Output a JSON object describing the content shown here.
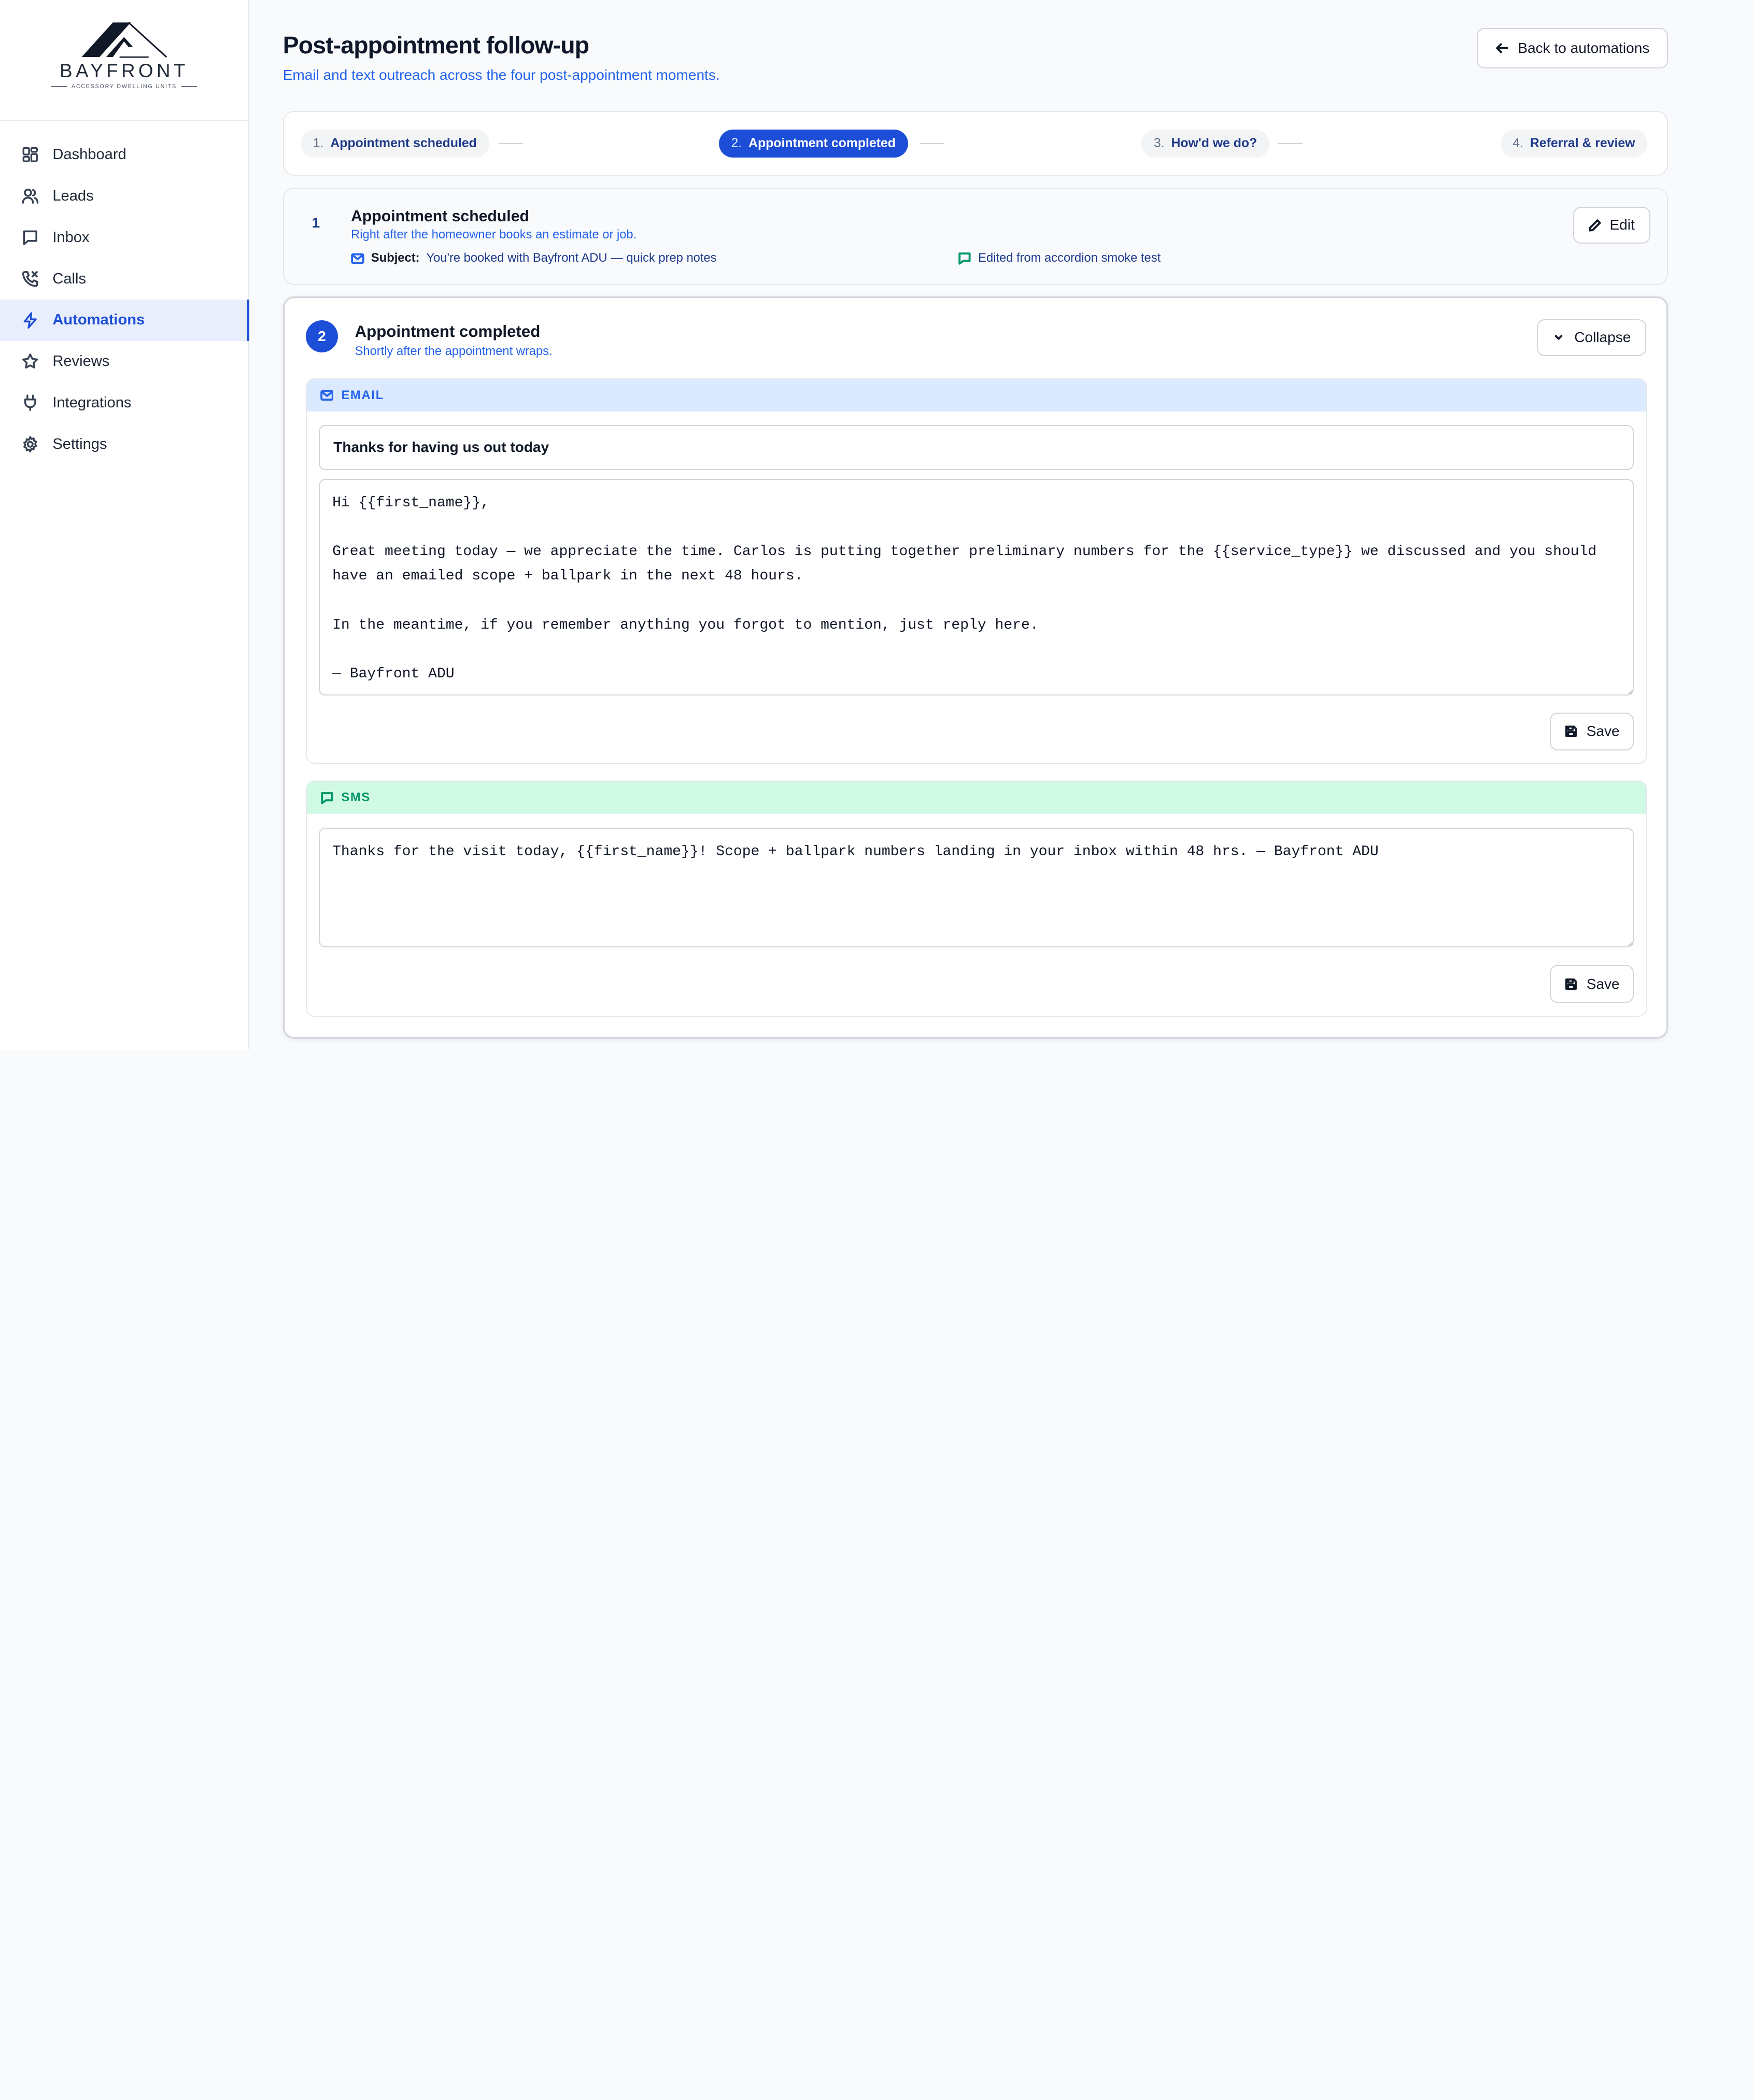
{
  "brand": {
    "name": "BAYFRONT",
    "tagline": "ACCESSORY DWELLING UNITS",
    "logo_icon": "house-roof-icon"
  },
  "sidebar": {
    "items": [
      {
        "label": "Dashboard",
        "icon": "dashboard-icon",
        "active": false
      },
      {
        "label": "Leads",
        "icon": "users-icon",
        "active": false
      },
      {
        "label": "Inbox",
        "icon": "message-icon",
        "active": false
      },
      {
        "label": "Calls",
        "icon": "phone-icon",
        "active": false
      },
      {
        "label": "Automations",
        "icon": "lightning-icon",
        "active": true
      },
      {
        "label": "Reviews",
        "icon": "star-icon",
        "active": false
      },
      {
        "label": "Integrations",
        "icon": "plug-icon",
        "active": false
      },
      {
        "label": "Settings",
        "icon": "gear-icon",
        "active": false
      }
    ]
  },
  "header": {
    "title": "Post-appointment follow-up",
    "subtitle": "Email and text outreach across the four post-appointment moments.",
    "back_label": "Back to automations"
  },
  "stepper": {
    "steps": [
      {
        "num": "1.",
        "label": "Appointment scheduled",
        "active": false
      },
      {
        "num": "2.",
        "label": "Appointment completed",
        "active": true
      },
      {
        "num": "3.",
        "label": "How'd we do?",
        "active": false
      },
      {
        "num": "4.",
        "label": "Referral & review",
        "active": false
      }
    ]
  },
  "card1": {
    "index": "1",
    "title": "Appointment scheduled",
    "description": "Right after the homeowner books an estimate or job.",
    "subject_label": "Subject:",
    "subject": "You're booked with Bayfront ADU — quick prep notes",
    "sms_preview": "Edited from accordion smoke test",
    "edit_label": "Edit"
  },
  "card2": {
    "index": "2",
    "title": "Appointment completed",
    "description": "Shortly after the appointment wraps.",
    "collapse_label": "Collapse",
    "email": {
      "heading": "EMAIL",
      "subject": "Thanks for having us out today",
      "body": "Hi {{first_name}},\n\nGreat meeting today — we appreciate the time. Carlos is putting together preliminary numbers for the {{service_type}} we discussed and you should have an emailed scope + ballpark in the next 48 hours.\n\nIn the meantime, if you remember anything you forgot to mention, just reply here.\n\n— Bayfront ADU",
      "save_label": "Save"
    },
    "sms": {
      "heading": "SMS",
      "body": "Thanks for the visit today, {{first_name}}! Scope + ballpark numbers landing in your inbox within 48 hrs. — Bayfront ADU",
      "save_label": "Save"
    }
  },
  "colors": {
    "accent": "#1d4ed8",
    "link": "#2563eb",
    "email_header_bg": "#dbeafe",
    "sms_header_bg": "#d1fae5",
    "sms_accent": "#059669"
  }
}
